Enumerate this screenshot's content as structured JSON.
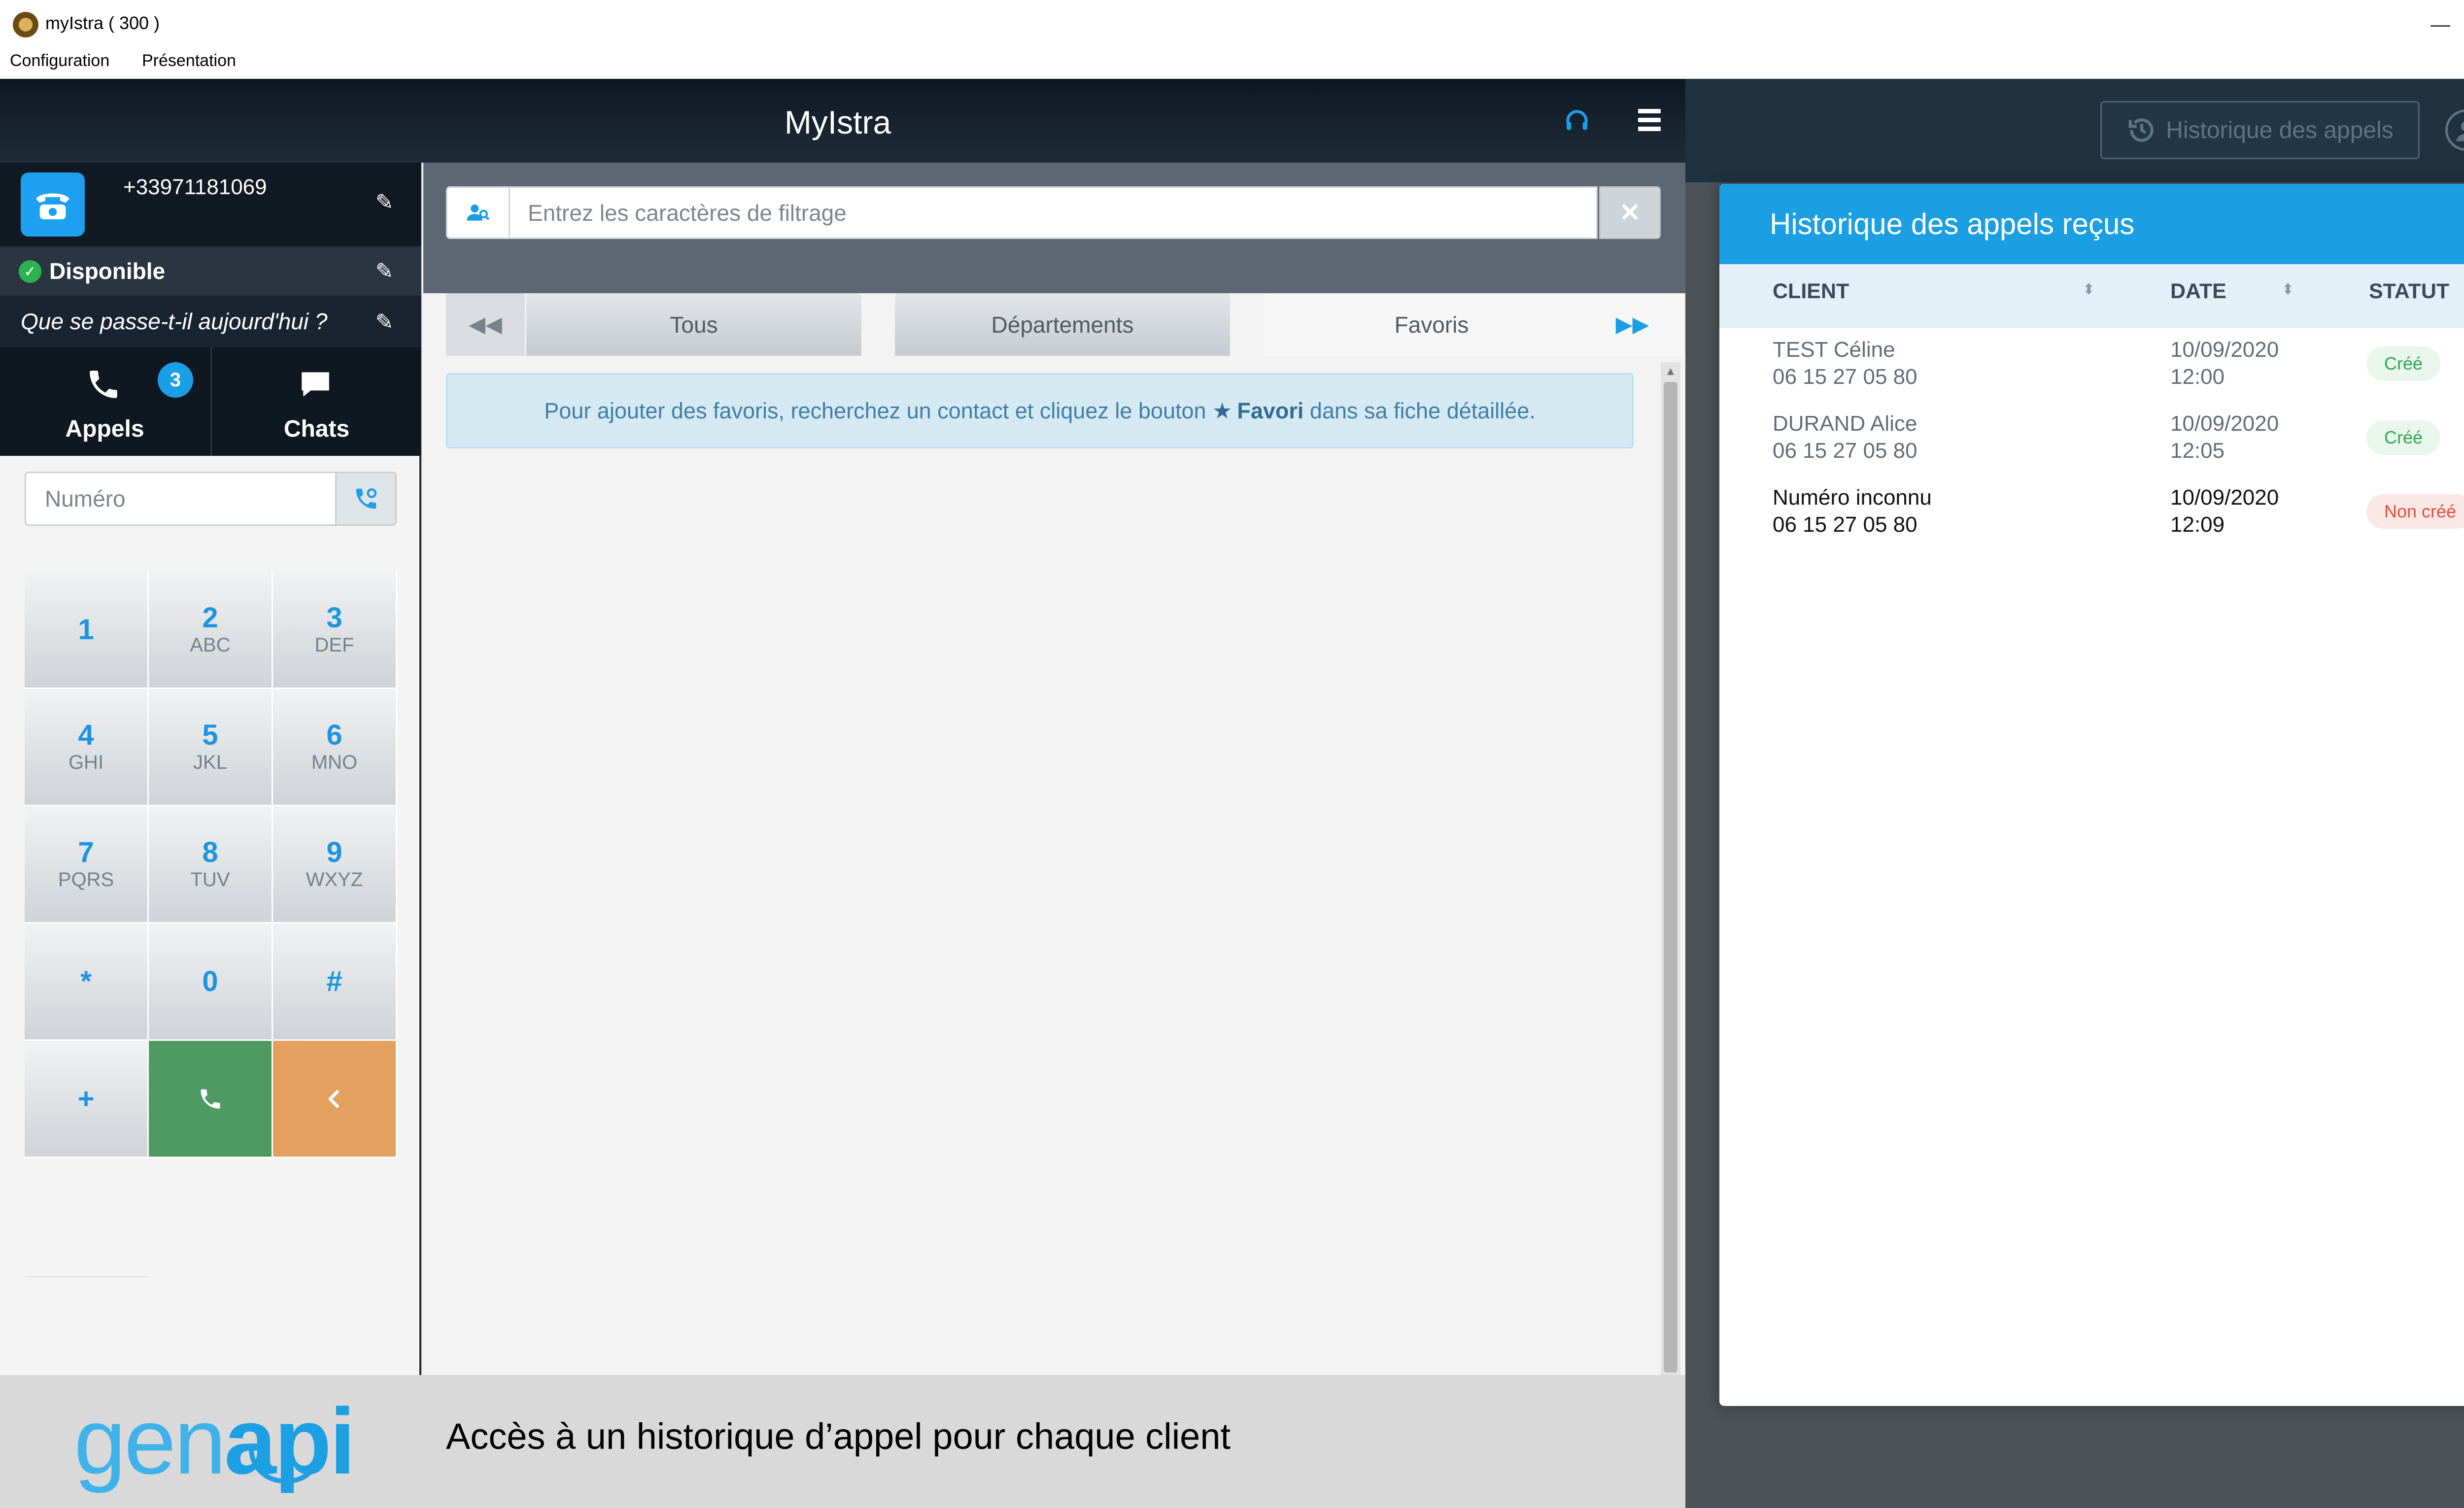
{
  "window": {
    "title": "myIstra ( 300 )",
    "controls": {
      "minimize": "—",
      "maximize": "☐",
      "close": "✕"
    }
  },
  "menu": {
    "items": [
      "Configuration",
      "Présentation"
    ]
  },
  "app": {
    "title": "MyIstra"
  },
  "profile": {
    "number": "+33971181069",
    "status": "Disponible",
    "mood": "Que se passe-t-il aujourd'hui ?"
  },
  "nav": {
    "appels_label": "Appels",
    "appels_badge": "3",
    "chats_label": "Chats"
  },
  "dialer": {
    "placeholder": "Numéro",
    "keys": [
      {
        "digit": "1",
        "letters": ""
      },
      {
        "digit": "2",
        "letters": "ABC"
      },
      {
        "digit": "3",
        "letters": "DEF"
      },
      {
        "digit": "4",
        "letters": "GHI"
      },
      {
        "digit": "5",
        "letters": "JKL"
      },
      {
        "digit": "6",
        "letters": "MNO"
      },
      {
        "digit": "7",
        "letters": "PQRS"
      },
      {
        "digit": "8",
        "letters": "TUV"
      },
      {
        "digit": "9",
        "letters": "WXYZ"
      },
      {
        "digit": "*",
        "letters": ""
      },
      {
        "digit": "0",
        "letters": ""
      },
      {
        "digit": "#",
        "letters": ""
      },
      {
        "digit": "+",
        "letters": ""
      }
    ]
  },
  "filter": {
    "placeholder": "Entrez les caractères de filtrage",
    "clear": "✕"
  },
  "tabs": {
    "items": [
      "Tous",
      "Départements",
      "Favoris"
    ],
    "active": "Favoris"
  },
  "info": {
    "before": "Pour ajouter des favoris, recherchez un contact et cliquez le bouton ",
    "star": "★",
    "bold": "Favori",
    "after": " dans sa fiche détaillée."
  },
  "banner": {
    "logo_part1": "gen",
    "logo_part2": "api",
    "tagline": "Accès à un historique d’appel pour chaque client"
  },
  "header_right": {
    "history_button": "Historique des appels"
  },
  "modal": {
    "title": "Historique des appels reçus",
    "close": "✕",
    "columns": [
      "CLIENT",
      "DATE",
      "STATUT"
    ],
    "rows": [
      {
        "name": "TEST Céline",
        "phone": "06 15 27 05 80",
        "date": "10/09/2020",
        "time": "12:00",
        "status": "Créé",
        "status_type": "ok"
      },
      {
        "name": "DURAND Alice",
        "phone": "06 15 27 05 80",
        "date": "10/09/2020",
        "time": "12:05",
        "status": "Créé",
        "status_type": "ok"
      },
      {
        "name": "Numéro inconnu",
        "phone": "06 15 27 05 80",
        "date": "10/09/2020",
        "time": "12:09",
        "status": "Non créé",
        "status_type": "ko"
      }
    ]
  }
}
